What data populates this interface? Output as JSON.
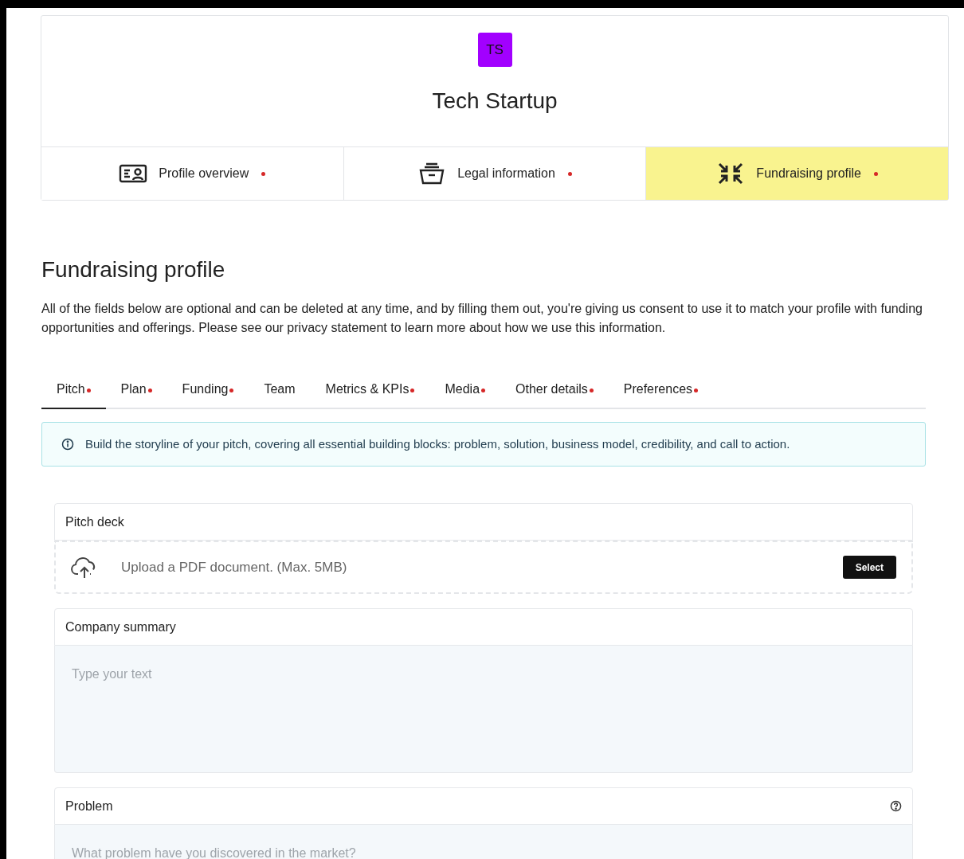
{
  "company": {
    "initials": "TS",
    "name": "Tech Startup"
  },
  "steps": [
    {
      "label": "Profile overview",
      "incomplete": true,
      "selected": false
    },
    {
      "label": "Legal information",
      "incomplete": true,
      "selected": false
    },
    {
      "label": "Fundraising profile",
      "incomplete": true,
      "selected": true
    }
  ],
  "section": {
    "title": "Fundraising profile",
    "description": "All of the fields below are optional and can be deleted at any time, and by filling them out, you're giving us consent to use it to match your profile with funding opportunities and offerings. Please see our privacy statement to learn more about how we use this information."
  },
  "tabs": [
    {
      "label": "Pitch",
      "incomplete": true,
      "selected": true
    },
    {
      "label": "Plan",
      "incomplete": true,
      "selected": false
    },
    {
      "label": "Funding",
      "incomplete": true,
      "selected": false
    },
    {
      "label": "Team",
      "incomplete": false,
      "selected": false
    },
    {
      "label": "Metrics & KPIs",
      "incomplete": true,
      "selected": false
    },
    {
      "label": "Media",
      "incomplete": true,
      "selected": false
    },
    {
      "label": "Other details",
      "incomplete": true,
      "selected": false
    },
    {
      "label": "Preferences",
      "incomplete": true,
      "selected": false
    }
  ],
  "info_banner": "Build the storyline of your pitch, covering all essential building blocks: problem, solution, business model, credibility, and call to action.",
  "fields": [
    {
      "kind": "upload",
      "label": "Pitch deck",
      "help": false,
      "hint": "Upload a PDF document. (Max. 5MB)",
      "button": "Select"
    },
    {
      "kind": "textarea",
      "label": "Company summary",
      "help": false,
      "placeholder": "Type your text"
    },
    {
      "kind": "textarea",
      "label": "Problem",
      "help": true,
      "placeholder": "What problem have you discovered in the market?"
    }
  ]
}
